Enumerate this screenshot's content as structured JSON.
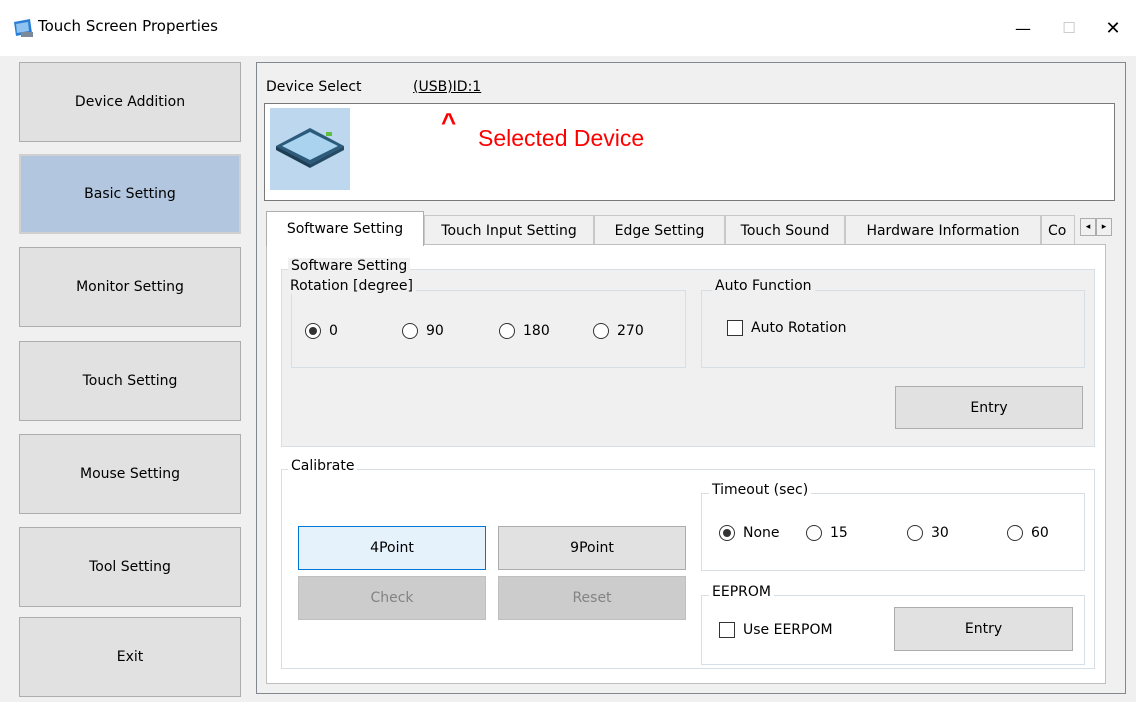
{
  "window": {
    "title": "Touch Screen Properties",
    "minimize_glyph": "—",
    "maximize_glyph": "☐",
    "close_glyph": "✕"
  },
  "sidebar": {
    "items": [
      {
        "label": "Device Addition",
        "active": false
      },
      {
        "label": "Basic Setting",
        "active": true
      },
      {
        "label": "Monitor Setting",
        "active": false
      },
      {
        "label": "Touch Setting",
        "active": false
      },
      {
        "label": "Mouse Setting",
        "active": false
      },
      {
        "label": "Tool Setting",
        "active": false
      },
      {
        "label": "Exit",
        "active": false
      }
    ]
  },
  "device": {
    "select_label": "Device Select",
    "selected_id": "(USB)ID:1",
    "annotation_caret": "^",
    "annotation_text": "Selected Device"
  },
  "tabs": [
    {
      "label": "Software Setting",
      "active": true
    },
    {
      "label": "Touch Input Setting",
      "active": false
    },
    {
      "label": "Edge Setting",
      "active": false
    },
    {
      "label": "Touch Sound",
      "active": false
    },
    {
      "label": "Hardware Information",
      "active": false
    },
    {
      "label": "Co",
      "active": false
    }
  ],
  "tab_scroll": {
    "left": "◂",
    "right": "▸"
  },
  "software_setting": {
    "group_title": "Software Setting",
    "rotation": {
      "title": "Rotation [degree]",
      "options": [
        "0",
        "90",
        "180",
        "270"
      ],
      "selected": "0"
    },
    "auto_function": {
      "title": "Auto Function",
      "auto_rotation_label": "Auto Rotation",
      "auto_rotation_checked": false
    },
    "entry_label": "Entry"
  },
  "calibrate": {
    "group_title": "Calibrate",
    "point4_label": "4Point",
    "point9_label": "9Point",
    "check_label": "Check",
    "reset_label": "Reset",
    "timeout": {
      "title": "Timeout (sec)",
      "options": [
        "None",
        "15",
        "30",
        "60"
      ],
      "selected": "None"
    },
    "eeprom": {
      "title": "EEPROM",
      "use_label": "Use EERPOM",
      "use_checked": false,
      "entry_label": "Entry"
    }
  },
  "colors": {
    "accent": "#0078d7",
    "active_nav": "#b2c6df",
    "annotation": "#ff0000"
  }
}
